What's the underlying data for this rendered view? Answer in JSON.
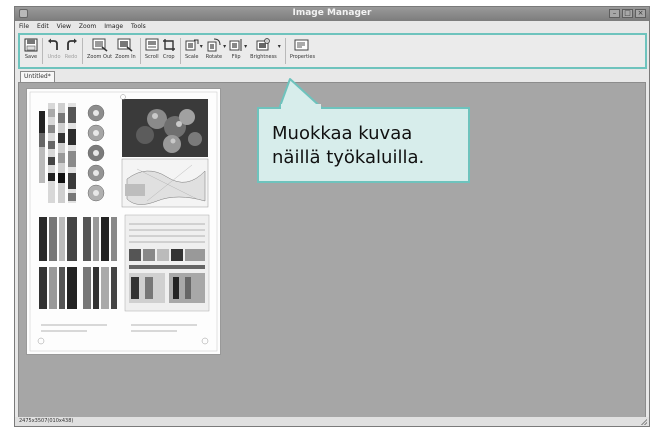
{
  "window": {
    "title": "Image Manager",
    "controls": [
      "minimize",
      "maximize",
      "close"
    ]
  },
  "menu": [
    {
      "label": "File"
    },
    {
      "label": "Edit"
    },
    {
      "label": "View"
    },
    {
      "label": "Zoom"
    },
    {
      "label": "Image"
    },
    {
      "label": "Tools"
    }
  ],
  "toolbar": {
    "buttons": [
      {
        "label": "Save",
        "icon": "save-icon",
        "disabled": false
      },
      {
        "label": "Undo",
        "icon": "undo-icon",
        "disabled": true
      },
      {
        "label": "Redo",
        "icon": "redo-icon",
        "disabled": true
      },
      {
        "label": "Zoom Out",
        "icon": "zoom-out-icon",
        "disabled": false
      },
      {
        "label": "Zoom In",
        "icon": "zoom-in-icon",
        "disabled": false
      },
      {
        "label": "Scroll",
        "icon": "scroll-icon",
        "disabled": false
      },
      {
        "label": "Crop",
        "icon": "crop-icon",
        "disabled": false
      },
      {
        "label": "Scale",
        "icon": "scale-icon",
        "disabled": false
      },
      {
        "label": "Rotate",
        "icon": "rotate-icon",
        "disabled": false
      },
      {
        "label": "Flip",
        "icon": "flip-icon",
        "disabled": false
      },
      {
        "label": "Brightness",
        "icon": "brightness-icon",
        "disabled": false
      },
      {
        "label": "Properties",
        "icon": "properties-icon",
        "disabled": false
      }
    ]
  },
  "tab": {
    "label": "Untitled*"
  },
  "callout": {
    "line1": "Muokkaa kuvaa",
    "line2": "näillä työkaluilla."
  },
  "status": {
    "text": "2475x3507(010x438)"
  },
  "colors": {
    "accent": "#6ec3bd",
    "callout_bg": "#d7edeb",
    "canvas": "#a6a6a6",
    "titlebar": "#8a8a8a"
  }
}
